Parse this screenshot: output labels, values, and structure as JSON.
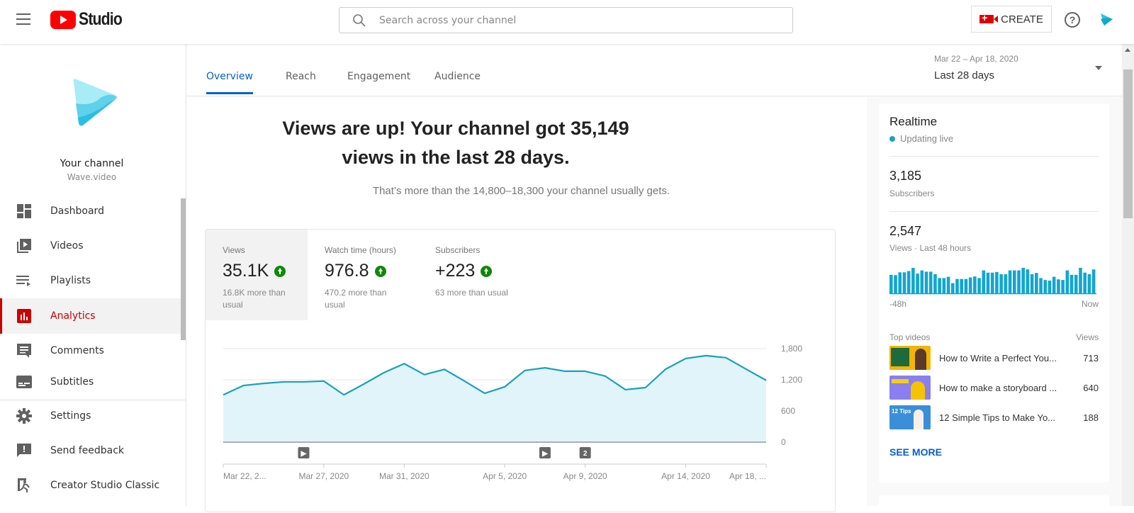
{
  "header": {
    "logo_text": "Studio",
    "search_placeholder": "Search across your channel",
    "create_label": "CREATE",
    "help_label": "?"
  },
  "sidebar": {
    "channel_name": "Your channel",
    "channel_sub": "Wave.video",
    "items": [
      {
        "label": "Dashboard",
        "icon": "dashboard-icon"
      },
      {
        "label": "Videos",
        "icon": "videos-icon"
      },
      {
        "label": "Playlists",
        "icon": "playlists-icon"
      },
      {
        "label": "Analytics",
        "icon": "analytics-icon",
        "active": true
      },
      {
        "label": "Comments",
        "icon": "comments-icon"
      },
      {
        "label": "Subtitles",
        "icon": "subtitles-icon"
      }
    ],
    "bottom_items": [
      {
        "label": "Settings",
        "icon": "gear-icon"
      },
      {
        "label": "Send feedback",
        "icon": "feedback-icon"
      },
      {
        "label": "Creator Studio Classic",
        "icon": "exit-icon"
      }
    ]
  },
  "tabs": [
    {
      "label": "Overview",
      "active": true
    },
    {
      "label": "Reach"
    },
    {
      "label": "Engagement"
    },
    {
      "label": "Audience"
    }
  ],
  "date_selector": {
    "range": "Mar 22 – Apr 18, 2020",
    "label": "Last 28 days"
  },
  "overview": {
    "headline": "Views are up! Your channel got 35,149 views in the last 28 days.",
    "subline": "That’s more than the 14,800–18,300 your channel usually gets.",
    "metrics": [
      {
        "label": "Views",
        "value": "35.1K",
        "note": "16.8K more than usual",
        "trend": "up",
        "active": true
      },
      {
        "label": "Watch time (hours)",
        "value": "976.8",
        "note": "470.2 more than usual",
        "trend": "up"
      },
      {
        "label": "Subscribers",
        "value": "+223",
        "note": "63 more than usual",
        "trend": "up"
      }
    ]
  },
  "chart_data": {
    "type": "area",
    "title": "Views",
    "x": [
      "Mar 22",
      "Mar 23",
      "Mar 24",
      "Mar 25",
      "Mar 26",
      "Mar 27",
      "Mar 28",
      "Mar 29",
      "Mar 30",
      "Mar 31",
      "Apr 1",
      "Apr 2",
      "Apr 3",
      "Apr 4",
      "Apr 5",
      "Apr 6",
      "Apr 7",
      "Apr 8",
      "Apr 9",
      "Apr 10",
      "Apr 11",
      "Apr 12",
      "Apr 13",
      "Apr 14",
      "Apr 15",
      "Apr 16",
      "Apr 17",
      "Apr 18"
    ],
    "values": [
      910,
      1090,
      1130,
      1160,
      1160,
      1175,
      910,
      1120,
      1340,
      1510,
      1300,
      1400,
      1175,
      940,
      1065,
      1380,
      1430,
      1365,
      1365,
      1270,
      1010,
      1050,
      1405,
      1610,
      1665,
      1625,
      1405,
      1190
    ],
    "x_tick_labels": [
      "Mar 22, 2...",
      "Mar 27, 2020",
      "Mar 31, 2020",
      "Apr 5, 2020",
      "Apr 9, 2020",
      "Apr 14, 2020",
      "Apr 18, ..."
    ],
    "x_tick_indices": [
      0,
      5,
      9,
      14,
      18,
      23,
      27
    ],
    "y_ticks": [
      "0",
      "600",
      "1,200",
      "1,800"
    ],
    "ylim": [
      0,
      1800
    ],
    "grid": true,
    "markers": [
      {
        "index": 4,
        "label": "▶",
        "type": "video"
      },
      {
        "index": 16,
        "label": "▶",
        "type": "video"
      },
      {
        "index": 18,
        "label": "2",
        "type": "count"
      }
    ],
    "color": "#1aa0c0"
  },
  "realtime": {
    "title": "Realtime",
    "live_label": "Updating live",
    "subscribers_value": "3,185",
    "subscribers_label": "Subscribers",
    "views_value": "2,547",
    "views_label": "Views · Last 48 hours",
    "axis_start": "-48h",
    "axis_end": "Now",
    "hourly_views": [
      58,
      57,
      66,
      66,
      70,
      80,
      62,
      72,
      68,
      68,
      60,
      48,
      48,
      52,
      32,
      45,
      45,
      45,
      50,
      53,
      48,
      72,
      65,
      65,
      67,
      60,
      60,
      72,
      72,
      72,
      80,
      75,
      60,
      64,
      48,
      42,
      40,
      52,
      44,
      42,
      72,
      58,
      58,
      80,
      65,
      60,
      75
    ],
    "top_videos_label": "Top videos",
    "views_col_label": "Views",
    "top_videos": [
      {
        "title": "How to Write a Perfect You...",
        "views": "713",
        "thumb_color": "#f5b400"
      },
      {
        "title": "How to make a storyboard ...",
        "views": "640",
        "thumb_color": "#8a7ff0"
      },
      {
        "title": "12 Simple Tips to Make Yo...",
        "views": "188",
        "thumb_color": "#3a8fd8"
      }
    ],
    "see_more": "SEE MORE"
  }
}
